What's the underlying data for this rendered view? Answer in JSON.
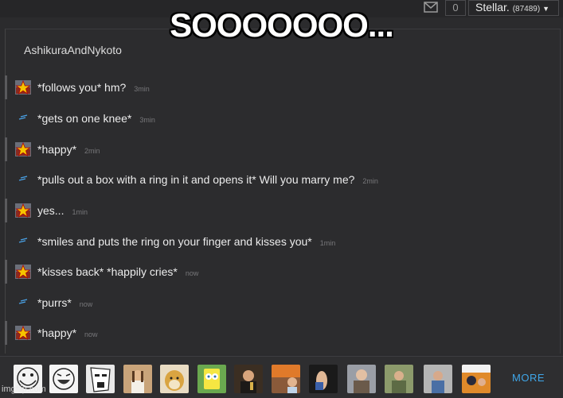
{
  "meme_caption": "SOOOOOOO...",
  "topbar": {
    "notification_count": "0",
    "username": "Stellar.",
    "points": "(87489)"
  },
  "chat": {
    "title": "AshikuraAndNykoto",
    "messages": [
      {
        "sender": "ashikura",
        "text": "*follows you* hm?",
        "time": "3min"
      },
      {
        "sender": "stellar",
        "text": "*gets on one knee*",
        "time": "3min"
      },
      {
        "sender": "ashikura",
        "text": "*happy*",
        "time": "2min"
      },
      {
        "sender": "stellar",
        "text": "*pulls out a box with a ring in it and opens it* Will you marry me?",
        "time": "2min"
      },
      {
        "sender": "ashikura",
        "text": "yes...",
        "time": "1min"
      },
      {
        "sender": "stellar",
        "text": "*smiles and puts the ring on your finger and kisses you*",
        "time": "1min"
      },
      {
        "sender": "ashikura",
        "text": "*kisses back* *happily cries*",
        "time": "now"
      },
      {
        "sender": "stellar",
        "text": "*purrs*",
        "time": "now"
      },
      {
        "sender": "ashikura",
        "text": "*happy*",
        "time": "now"
      }
    ]
  },
  "meme_picker": {
    "more_label": "MORE",
    "thumbnails": [
      "troll-face",
      "lol-face",
      "y-u-no-face",
      "jesus",
      "doge",
      "spongebob",
      "leonardo",
      "disaster-girl",
      "hand",
      "bernie",
      "soldier",
      "guy",
      "batman-slap"
    ]
  },
  "watermark": "imgflip.com"
}
